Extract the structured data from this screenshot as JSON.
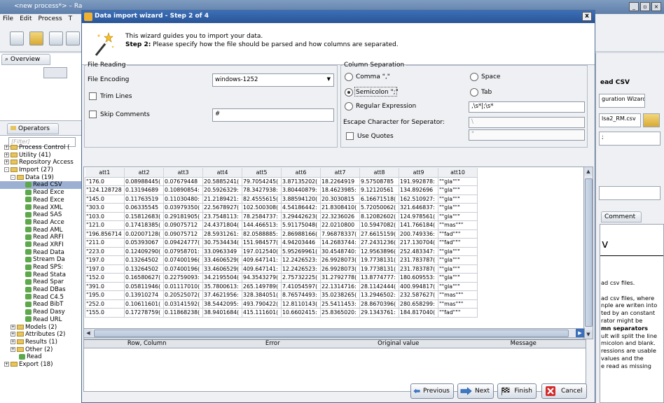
{
  "app": {
    "title": "<new process*> – Ra",
    "menu": [
      "File",
      "Edit",
      "Process",
      "T"
    ],
    "overview_tab": "Overview",
    "operators_tab": "Operators",
    "filter_placeholder": "[Filter]",
    "tree": [
      {
        "label": "Process Control (",
        "level": 0,
        "kind": "folder",
        "sign": "+"
      },
      {
        "label": "Utility (41)",
        "level": 0,
        "kind": "folder",
        "sign": "+"
      },
      {
        "label": "Repository Access",
        "level": 0,
        "kind": "folder",
        "sign": "+"
      },
      {
        "label": "Import (27)",
        "level": 0,
        "kind": "folder",
        "sign": "-"
      },
      {
        "label": "Data (19)",
        "level": 1,
        "kind": "folder",
        "sign": "-"
      },
      {
        "label": "Read CSV",
        "level": 2,
        "kind": "op",
        "selected": true
      },
      {
        "label": "Read Exce",
        "level": 2,
        "kind": "op"
      },
      {
        "label": "Read Exce",
        "level": 2,
        "kind": "op"
      },
      {
        "label": "Read XML",
        "level": 2,
        "kind": "op"
      },
      {
        "label": "Read SAS",
        "level": 2,
        "kind": "op"
      },
      {
        "label": "Read Acce",
        "level": 2,
        "kind": "op"
      },
      {
        "label": "Read AML",
        "level": 2,
        "kind": "op"
      },
      {
        "label": "Read ARFI",
        "level": 2,
        "kind": "op"
      },
      {
        "label": "Read XRFI",
        "level": 2,
        "kind": "op"
      },
      {
        "label": "Read Data",
        "level": 2,
        "kind": "op"
      },
      {
        "label": "Stream Da",
        "level": 2,
        "kind": "op"
      },
      {
        "label": "Read SPS:",
        "level": 2,
        "kind": "op"
      },
      {
        "label": "Read Stata",
        "level": 2,
        "kind": "op"
      },
      {
        "label": "Read Spar",
        "level": 2,
        "kind": "op"
      },
      {
        "label": "Read DBas",
        "level": 2,
        "kind": "op"
      },
      {
        "label": "Read C4.5",
        "level": 2,
        "kind": "op"
      },
      {
        "label": "Read BibT",
        "level": 2,
        "kind": "op"
      },
      {
        "label": "Read Dasy",
        "level": 2,
        "kind": "op"
      },
      {
        "label": "Read URL",
        "level": 2,
        "kind": "op"
      },
      {
        "label": "Models (2)",
        "level": 1,
        "kind": "folder",
        "sign": "+"
      },
      {
        "label": "Attributes (2)",
        "level": 1,
        "kind": "folder",
        "sign": "+"
      },
      {
        "label": "Results (1)",
        "level": 1,
        "kind": "folder",
        "sign": "+"
      },
      {
        "label": "Other (2)",
        "level": 1,
        "kind": "folder",
        "sign": "+"
      },
      {
        "label": "Read",
        "level": 1,
        "kind": "op"
      },
      {
        "label": "Export (18)",
        "level": 0,
        "kind": "folder",
        "sign": "+"
      }
    ],
    "right": {
      "read_csv": "ead CSV",
      "config_wizard": "guration Wizard...",
      "file_field": "lsa2_RM.csv",
      "sep_field": ";",
      "comment_tab": "Comment",
      "v_label": "v",
      "help_lines": [
        "ad csv files.",
        "",
        "ad csv files, where",
        "nple are writen into",
        "ted by an constant",
        "rator might be",
        "mn separators",
        "ult will split the line",
        "micolon and blank.",
        "ressions are usable",
        " values and the",
        "e read as missing"
      ]
    }
  },
  "dialog": {
    "title": "Data import wizard - Step 2 of 4",
    "close": "x",
    "intro_line1": "This wizard guides you to import your data.",
    "intro_step": "Step 2:",
    "intro_line2": " Please specify how the file should be parsed and how columns are separated.",
    "file_reading": {
      "legend": "File Reading",
      "encoding_label": "File Encoding",
      "encoding_value": "windows-1252",
      "trim_lines": "Trim Lines",
      "trim_checked": false,
      "skip_comments": "Skip Comments",
      "skip_checked": false,
      "comment_char": "#"
    },
    "column_separation": {
      "legend": "Column Separation",
      "comma": "Comma \",\"",
      "space": "Space",
      "semicolon": "Semicolon \";\"",
      "tab": "Tab",
      "regex": "Regular Expression",
      "regex_value": ",\\s*|;\\s*",
      "selected": "semicolon",
      "escape_label": "Escape Character for Seperator:",
      "escape_value": "\\",
      "use_quotes": "Use Quotes",
      "use_quotes_checked": false,
      "quote_value": "\""
    },
    "table": {
      "columns": [
        "att1",
        "att2",
        "att3",
        "att4",
        "att5",
        "att6",
        "att7",
        "att8",
        "att9",
        "att10"
      ],
      "rows": [
        [
          "\"176.0",
          "0.08988445(",
          "0.07679448",
          "20.5885241(",
          "79.7054245(",
          "3.87135202(",
          "18.2264919",
          "9.57508785",
          "191.992878:",
          "\"\"gla\"\"\""
        ],
        [
          "\"124.128728",
          "0.13194689",
          "0.10890854:",
          "20.5926329:",
          "78.3427938:",
          "3.80440879:",
          "18.4623985:",
          "9.12120561",
          "134.892696",
          "\"\"gla\"\"\""
        ],
        [
          "\"145.0",
          "0.11763519",
          "0.11030480:",
          "21.2189421:",
          "82.4555615(",
          "3.88594120(",
          "20.3030815",
          "6.16671518(",
          "162.510927:",
          "\"\"gla\"\"\""
        ],
        [
          "\"303.0",
          "0.06335545",
          "0.03979350(",
          "22.5678927(",
          "102.500308(",
          "4.54186442:",
          "21.8308410(",
          "5.72050062(",
          "321.646837:",
          "\"\"gla\"\"\""
        ],
        [
          "\"103.0",
          "0.15812683(",
          "0.29181905(",
          "23.7548113:",
          "78.2584737:",
          "3.29442623(",
          "22.3236026",
          "8.12082602(",
          "124.978561(",
          "\"\"gla\"\"\""
        ],
        [
          "\"121.0",
          "0.17418385(",
          "0.09075712",
          "24.4371804(",
          "144.466513:",
          "5.91175048(",
          "22.0210800",
          "10.5947082(",
          "141.766184(",
          "\"\"mas\"\"\""
        ],
        [
          "\"196.856714",
          "0.02007128(",
          "0.09075712",
          "28.5931261:",
          "82.0588885:",
          "2.86988166(",
          "7.96878337(",
          "27.6615159(",
          "200.749336:",
          "\"\"fad\"\"\""
        ],
        [
          "\"211.0",
          "0.05393067",
          "0.09424777(",
          "30.7534434(",
          "151.984577(",
          "4.94203446",
          "14.2683744:",
          "27.2431236(",
          "217.130704(",
          "\"\"fad\"\"\""
        ],
        [
          "\"223.0",
          "0.12409290(",
          "0.07958701:",
          "33.0963349",
          "197.012540(",
          "5.95269961(",
          "30.4548740:",
          "12.9563896(",
          "252.483347:",
          "\"\"gla\"\"\""
        ],
        [
          "\"197.0",
          "0.13264502",
          "0.07400196(",
          "33.4606529(",
          "409.647141:",
          "12.2426523:",
          "26.9928073(",
          "19.7738131(",
          "231.783787(",
          "\"\"gla\"\"\""
        ],
        [
          "\"197.0",
          "0.13264502",
          "0.07400196(",
          "33.4606529(",
          "409.647141:",
          "12.2426523:",
          "26.9928073(",
          "19.7738131(",
          "231.783787(",
          "\"\"gla\"\"\""
        ],
        [
          "\"152.0",
          "0.16580627(",
          "0.22759093:",
          "34.2195504(",
          "94.3543279(",
          "2.75732225(",
          "31.2792778(",
          "13.8774777:",
          "180.609553:",
          "\"\"gla\"\"\""
        ],
        [
          "\"391.0",
          "0.05811946(",
          "0.01117010(",
          "35.7800613:",
          "265.149789(",
          "7.41054597(",
          "22.1314716:",
          "28.1142444(",
          "400.994817(",
          "\"\"gla\"\"\""
        ],
        [
          "\"195.0",
          "0.13910274",
          "0.20525072(",
          "37.4621956:",
          "328.384051(",
          "8.76574493:",
          "35.0238265(",
          "13.2946502:",
          "232.587627(",
          "\"\"mas\"\"\""
        ],
        [
          "\"252.0",
          "0.10611601(",
          "0.03141592(",
          "38.5442095:",
          "493.790422(",
          "12.8110143(",
          "25.5411453:",
          "28.8670396(",
          "280.658299:",
          "\"\"mas\"\"\""
        ],
        [
          "\"155.0",
          "0.17278759(",
          "0.11868238(",
          "38.9401684(",
          "415.111601(",
          "10.6602415:",
          "25.8365020:",
          "29.1343761:",
          "184.817040(",
          "\"\"fad\"\"\""
        ]
      ]
    },
    "errors": {
      "headers": [
        "Row, Column",
        "Error",
        "Original value",
        "Message"
      ]
    },
    "buttons": {
      "previous": "Previous",
      "next": "Next",
      "finish": "Finish",
      "cancel": "Cancel"
    }
  }
}
